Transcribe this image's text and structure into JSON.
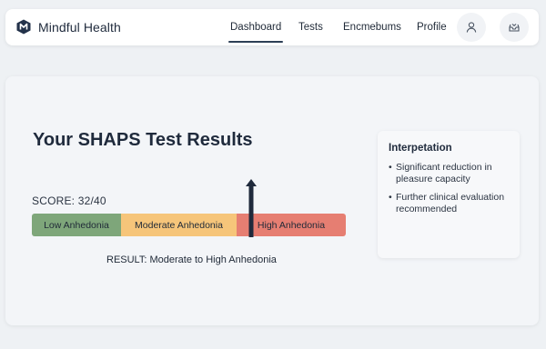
{
  "header": {
    "brand_name": "Mindful Health",
    "logo_icon": "hexagon-m-logo",
    "nav": [
      {
        "label": "Dashboard",
        "active": true
      },
      {
        "label": "Tests",
        "active": false
      },
      {
        "label": "Encmebums",
        "active": false
      },
      {
        "label": "Profile",
        "active": false
      }
    ],
    "user_icon": "user-icon",
    "notification_icon": "inbox-icon"
  },
  "main": {
    "title": "Your SHAPS Test Results",
    "score_label": "SCORE: 32/40",
    "score_value": 32,
    "score_max": 40,
    "scale": [
      {
        "label": "Low Anhedonia",
        "color": "#7ea67a"
      },
      {
        "label": "Moderate Anhedonia",
        "color": "#f6c57a"
      },
      {
        "label": "High Anhedonia",
        "color": "#e67e72"
      }
    ],
    "result_text": "RESULT: Moderate to High Anhedonia"
  },
  "interpretation": {
    "title": "Interpetation",
    "items": [
      "Significant reduction in pleasure capacity",
      "Further clinical evaluation recommended"
    ]
  },
  "colors": {
    "accent": "#2c3e55",
    "pointer": "#1f2a3c"
  }
}
